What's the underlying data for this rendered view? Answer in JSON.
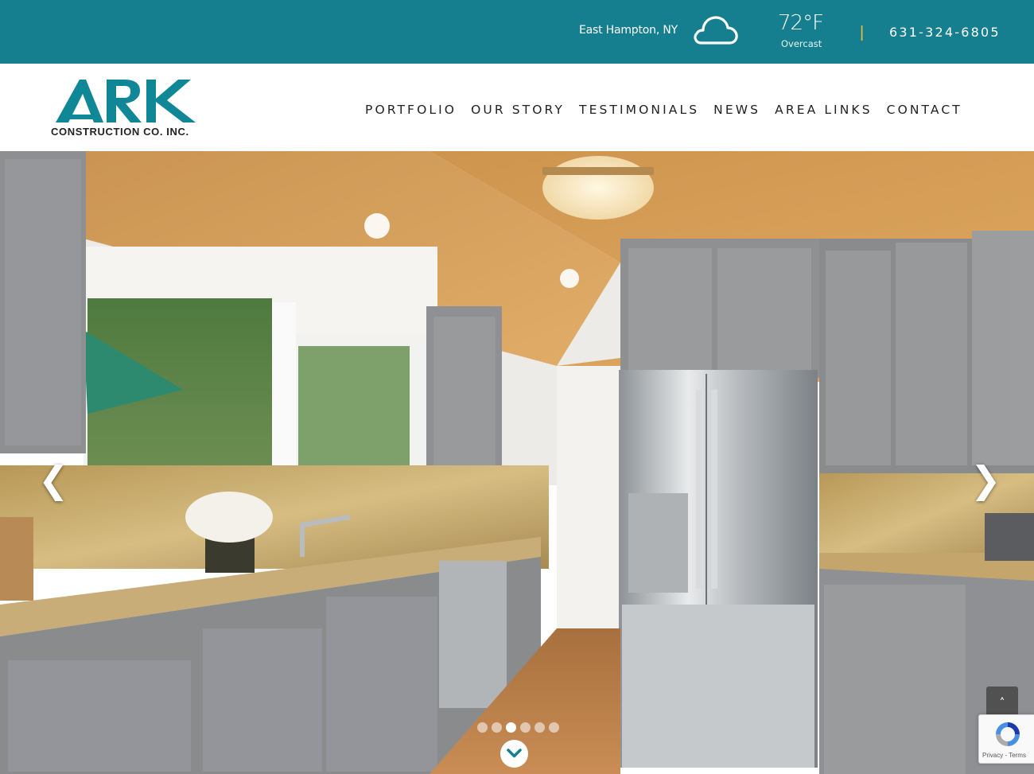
{
  "topbar": {
    "location": "East Hampton, NY",
    "weather_icon": "cloud-icon",
    "temperature": "72°F",
    "condition": "Overcast",
    "separator": "|",
    "phone": "631-324-6805"
  },
  "header": {
    "logo_text": "ARK",
    "logo_subtitle": "CONSTRUCTION CO. INC.",
    "nav": [
      {
        "label": "PORTFOLIO"
      },
      {
        "label": "OUR STORY"
      },
      {
        "label": "TESTIMONIALS"
      },
      {
        "label": "NEWS"
      },
      {
        "label": "AREA LINKS"
      },
      {
        "label": "CONTACT"
      }
    ]
  },
  "slider": {
    "prev_symbol": "❮",
    "next_symbol": "❯",
    "slide_count": 6,
    "active_slide": 3,
    "scroll_icon": "chevron-down-icon",
    "back_to_top_symbol": "˄"
  },
  "recaptcha": {
    "text": "Privacy - Terms"
  },
  "colors": {
    "brand_teal": "#167f8f",
    "separator_yellow": "#e6c23a"
  }
}
